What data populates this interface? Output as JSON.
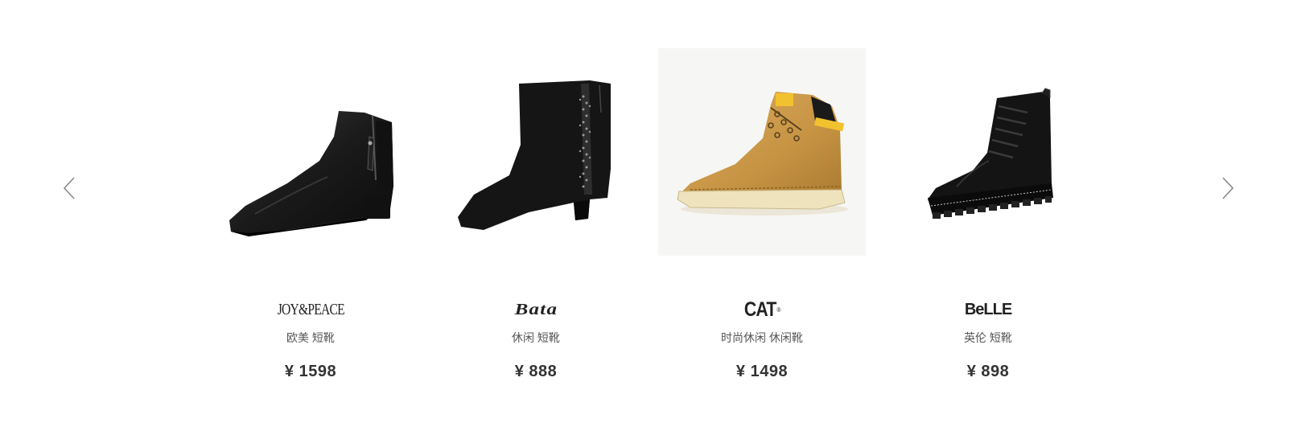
{
  "carousel": {
    "prev_icon": "chevron-left-icon",
    "next_icon": "chevron-right-icon",
    "colors": {
      "arrow": "#8a8a8a",
      "text": "#333333",
      "desc": "#555555"
    },
    "items": [
      {
        "brand": "JOY&PEACE",
        "desc": "欧美 短靴",
        "price": "¥ 1598",
        "image": "black-leather-ankle-boot"
      },
      {
        "brand": "Bata",
        "desc": "休闲 短靴",
        "price": "¥ 888",
        "image": "black-suede-block-heel-boot"
      },
      {
        "brand": "CAT",
        "brand_mark": "®",
        "desc": "时尚休闲 休闲靴",
        "price": "¥ 1498",
        "image": "tan-work-boot"
      },
      {
        "brand": "BeLLE",
        "desc": "英伦 短靴",
        "price": "¥ 898",
        "image": "black-lace-up-combat-boot"
      }
    ]
  }
}
